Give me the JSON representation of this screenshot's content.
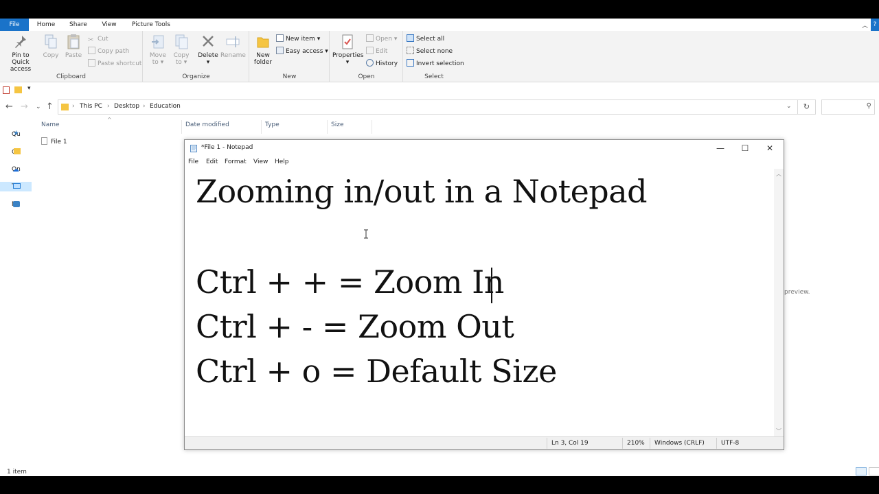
{
  "explorer": {
    "tabs": [
      "File",
      "Home",
      "Share",
      "View",
      "Picture Tools"
    ],
    "ribbon": {
      "clipboard": {
        "label": "Clipboard",
        "pin_line1": "Pin to Quick",
        "pin_line2": "access",
        "copy": "Copy",
        "paste": "Paste",
        "cut": "Cut",
        "copy_path": "Copy path",
        "paste_shortcut": "Paste shortcut"
      },
      "organize": {
        "label": "Organize",
        "move_line1": "Move",
        "move_line2": "to",
        "copy_line1": "Copy",
        "copy_line2": "to",
        "delete": "Delete",
        "rename": "Rename"
      },
      "new": {
        "label": "New",
        "folder_line1": "New",
        "folder_line2": "folder",
        "new_item": "New item",
        "easy_access": "Easy access"
      },
      "open": {
        "label": "Open",
        "properties": "Properties",
        "open": "Open",
        "edit": "Edit",
        "history": "History"
      },
      "select": {
        "label": "Select",
        "select_all": "Select all",
        "select_none": "Select none",
        "invert": "Invert selection"
      }
    },
    "breadcrumb": [
      "This PC",
      "Desktop",
      "Education"
    ],
    "nav_items": [
      "Qu",
      "Cr",
      "On",
      "Th",
      "Ne"
    ],
    "columns": [
      "Name",
      "Date modified",
      "Type",
      "Size"
    ],
    "files": [
      "File 1"
    ],
    "preview_hint": "preview.",
    "status": "1 item"
  },
  "notepad": {
    "title": "*File 1 - Notepad",
    "menu": [
      "File",
      "Edit",
      "Format",
      "View",
      "Help"
    ],
    "lines": [
      "Zooming in/out in a Notepad",
      "",
      "Ctrl + + = Zoom In",
      "Ctrl + - = Zoom Out",
      "Ctrl + o = Default Size"
    ],
    "status": {
      "position": "Ln 3, Col 19",
      "zoom": "210%",
      "line_endings": "Windows (CRLF)",
      "encoding": "UTF-8"
    }
  },
  "colors": {
    "accent": "#1a73c9",
    "ribbon_bg": "#f3f3f3",
    "selection": "#cce8ff"
  }
}
